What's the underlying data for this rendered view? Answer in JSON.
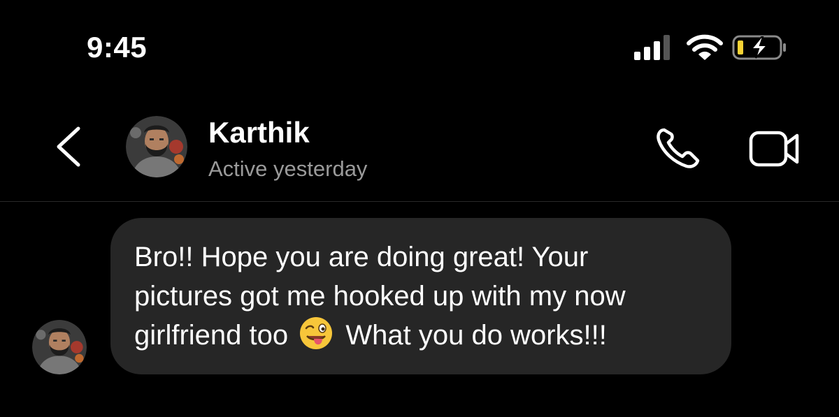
{
  "status_bar": {
    "time": "9:45",
    "icons": [
      "cellular-signal-icon",
      "wifi-icon",
      "battery-charging-icon"
    ],
    "battery_color": "#f7d335"
  },
  "header": {
    "back_icon": "chevron-left-icon",
    "contact_name": "Karthik",
    "contact_status": "Active yesterday",
    "call_icon": "phone-icon",
    "video_icon": "video-camera-icon"
  },
  "message": {
    "lines": [
      "Bro!! Hope you are doing great! Your",
      "pictures got me hooked up with my now",
      "girlfriend too"
    ],
    "emoji": "winking-face-with-tongue",
    "line3_after_emoji": "What you do works!!!"
  },
  "colors": {
    "background": "#000000",
    "bubble": "#262626",
    "secondary_text": "#9a9a9a"
  }
}
